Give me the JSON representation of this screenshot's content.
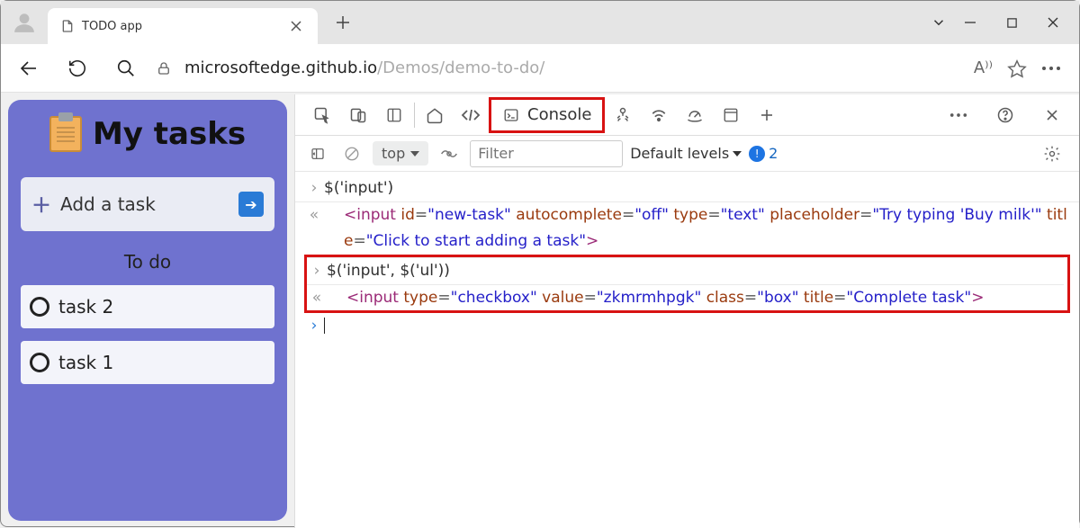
{
  "titlebar": {
    "tab_title": "TODO app"
  },
  "nav": {
    "url_host": "microsoftedge.github.io",
    "url_path": "/Demos/demo-to-do/",
    "read_aloud_label": "A⁾⁾"
  },
  "app": {
    "title": "My tasks",
    "add_task_label": "Add a task",
    "section_label": "To do",
    "tasks": [
      {
        "label": "task 2"
      },
      {
        "label": "task 1"
      }
    ]
  },
  "devtools": {
    "tabs": {
      "console": "Console"
    },
    "bar2": {
      "context": "top",
      "filter_placeholder": "Filter",
      "levels": "Default levels",
      "issue_count": "2"
    },
    "console": {
      "line1": "$('input')",
      "line2_parts": {
        "tag_open": "<input",
        "a1": "id",
        "v1": "\"new-task\"",
        "a2": "autocomplete",
        "v2": "\"off\"",
        "a3": "type",
        "v3": "\"text\"",
        "a4": "placeholder",
        "v4": "\"Try typing 'Buy milk'\"",
        "a5": "title",
        "v5": "\"Click to start adding a task\"",
        "tag_close": ">"
      },
      "line3": "$('input', $('ul'))",
      "line4_parts": {
        "tag_open": "<input",
        "a1": "type",
        "v1": "\"checkbox\"",
        "a2": "value",
        "v2": "\"zkmrmhpgk\"",
        "a3": "class",
        "v3": "\"box\"",
        "a4": "title",
        "v4": "\"Complete task\"",
        "tag_close": ">"
      }
    }
  }
}
